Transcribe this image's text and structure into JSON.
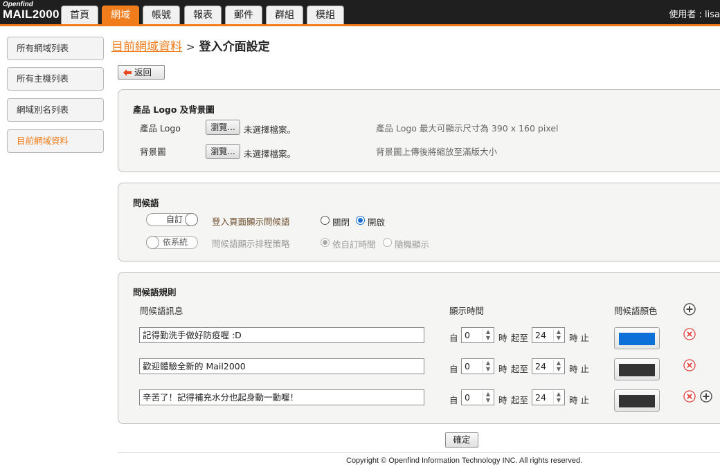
{
  "app": {
    "logo_small": "Openfind",
    "logo_big": "MAIL2000",
    "user_label": "使用者 : lisa"
  },
  "nav": {
    "tabs": [
      {
        "label": "首頁",
        "active": false
      },
      {
        "label": "網域",
        "active": true
      },
      {
        "label": "帳號",
        "active": false
      },
      {
        "label": "報表",
        "active": false
      },
      {
        "label": "郵件",
        "active": false
      },
      {
        "label": "群組",
        "active": false
      },
      {
        "label": "模組",
        "active": false
      }
    ]
  },
  "sidebar": {
    "items": [
      {
        "label": "所有網域列表",
        "active": false
      },
      {
        "label": "所有主機列表",
        "active": false
      },
      {
        "label": "網域別名列表",
        "active": false
      },
      {
        "label": "目前網域資料",
        "active": true
      }
    ]
  },
  "breadcrumb": {
    "parent": "目前網域資料",
    "separator": ">",
    "current": "登入介面設定"
  },
  "back_label": "返回",
  "logo_section": {
    "title": "產品 Logo 及背景圖",
    "rows": [
      {
        "label": "產品 Logo",
        "browse": "瀏覽...",
        "status": "未選擇檔案。",
        "hint": "產品 Logo 最大可顯示尺寸為 390 x 160 pixel"
      },
      {
        "label": "背景圖",
        "browse": "瀏覽...",
        "status": "未選擇檔案。",
        "hint": "背景圖上傳後將縮放至滿版大小"
      }
    ]
  },
  "greeting_section": {
    "title": "問候語",
    "row1": {
      "toggle": "自訂",
      "label": "登入頁面顯示問候語",
      "options": [
        {
          "label": "關閉",
          "selected": false
        },
        {
          "label": "開啟",
          "selected": true
        }
      ]
    },
    "row2": {
      "toggle": "依系統",
      "label": "問候語顯示排程策略",
      "options": [
        {
          "label": "依自訂時間",
          "selected": true
        },
        {
          "label": "隨機顯示",
          "selected": false
        }
      ]
    }
  },
  "rules_section": {
    "title": "問候語規則",
    "col_message": "問候語訊息",
    "col_time": "顯示時間",
    "col_color": "問候語顏色",
    "from": "自",
    "hour": "時",
    "to": "起至",
    "end": "時 止",
    "rows": [
      {
        "message": "記得勤洗手做好防疫喔 :D",
        "start": "0",
        "stop": "24",
        "color": "#0d6fd8"
      },
      {
        "message": "歡迎體驗全新的 Mail2000",
        "start": "0",
        "stop": "24",
        "color": "#333333"
      },
      {
        "message": "辛苦了！記得補充水分也起身動一動喔！",
        "start": "0",
        "stop": "24",
        "color": "#333333"
      }
    ]
  },
  "confirm_label": "確定",
  "copyright": "Copyright © Openfind Information Technology INC. All rights reserved.",
  "colors": {
    "accent": "#f07c1b",
    "topbar": "#1f1f1f",
    "remove": "#e0403a"
  }
}
